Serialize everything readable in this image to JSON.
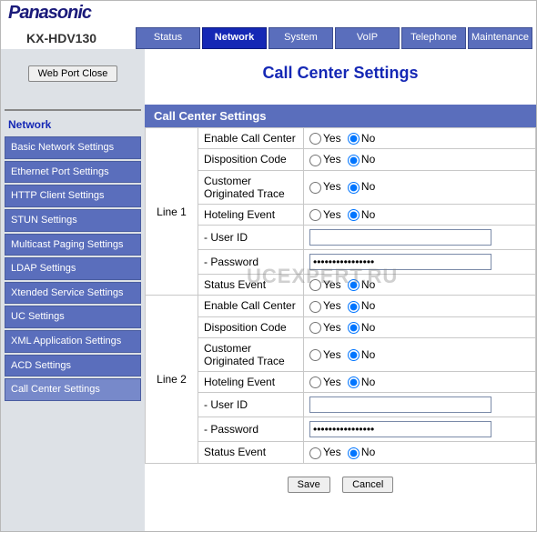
{
  "brand": "Panasonic",
  "model": "KX-HDV130",
  "tabs": [
    "Status",
    "Network",
    "System",
    "VoIP",
    "Telephone",
    "Maintenance"
  ],
  "active_tab": 1,
  "webport_btn": "Web Port Close",
  "side_title": "Network",
  "side_items": [
    "Basic Network Settings",
    "Ethernet Port Settings",
    "HTTP Client Settings",
    "STUN Settings",
    "Multicast Paging Settings",
    "LDAP Settings",
    "Xtended Service Settings",
    "UC Settings",
    "XML Application Settings",
    "ACD Settings",
    "Call Center Settings"
  ],
  "side_active": 10,
  "page_title": "Call Center Settings",
  "section_title": "Call Center Settings",
  "yes": "Yes",
  "no": "No",
  "lines": [
    {
      "name": "Line 1",
      "enable_call_center": "No",
      "disposition_code": "No",
      "customer_originated_trace": "No",
      "hoteling_event": "No",
      "user_id": "",
      "password": "••••••••••••••••",
      "status_event": "No"
    },
    {
      "name": "Line 2",
      "enable_call_center": "No",
      "disposition_code": "No",
      "customer_originated_trace": "No",
      "hoteling_event": "No",
      "user_id": "",
      "password": "••••••••••••••••",
      "status_event": "No"
    }
  ],
  "labels": {
    "enable_call_center": "Enable Call Center",
    "disposition_code": "Disposition Code",
    "customer_originated_trace": "Customer Originated Trace",
    "hoteling_event": "Hoteling Event",
    "user_id": "- User ID",
    "password": "- Password",
    "status_event": "Status Event"
  },
  "save_btn": "Save",
  "cancel_btn": "Cancel",
  "watermark": "UCEXPERT.RU"
}
